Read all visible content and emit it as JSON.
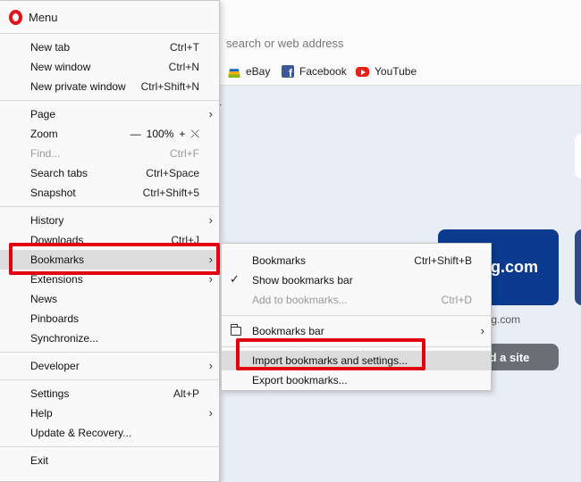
{
  "background": {
    "address_placeholder": "search or web address",
    "bookmarks": [
      {
        "label": "eBay",
        "icon": "ebay-icon"
      },
      {
        "label": "Facebook",
        "icon": "facebook-icon"
      },
      {
        "label": "YouTube",
        "icon": "youtube-icon"
      }
    ],
    "fragment_r": "r",
    "tile_text": "ing.com",
    "tile_caption": "ing.com",
    "add_site": "d a site"
  },
  "menu": {
    "title": "Menu",
    "new_tab": {
      "label": "New tab",
      "shortcut": "Ctrl+T"
    },
    "new_window": {
      "label": "New window",
      "shortcut": "Ctrl+N"
    },
    "new_private": {
      "label": "New private window",
      "shortcut": "Ctrl+Shift+N"
    },
    "page": {
      "label": "Page"
    },
    "zoom": {
      "label": "Zoom",
      "minus": "—",
      "value": "100%",
      "plus": "+",
      "fullscreen": "⤬"
    },
    "find": {
      "label": "Find...",
      "shortcut": "Ctrl+F"
    },
    "search_tabs": {
      "label": "Search tabs",
      "shortcut": "Ctrl+Space"
    },
    "snapshot": {
      "label": "Snapshot",
      "shortcut": "Ctrl+Shift+5"
    },
    "history": {
      "label": "History"
    },
    "downloads": {
      "label": "Downloads",
      "shortcut": "Ctrl+J"
    },
    "bookmarks": {
      "label": "Bookmarks"
    },
    "extensions": {
      "label": "Extensions"
    },
    "news": {
      "label": "News"
    },
    "pinboards": {
      "label": "Pinboards"
    },
    "synchronize": {
      "label": "Synchronize..."
    },
    "developer": {
      "label": "Developer"
    },
    "settings": {
      "label": "Settings",
      "shortcut": "Alt+P"
    },
    "help": {
      "label": "Help"
    },
    "update": {
      "label": "Update & Recovery..."
    },
    "exit": {
      "label": "Exit"
    },
    "arrow": "›"
  },
  "submenu": {
    "bookmarks": {
      "label": "Bookmarks",
      "shortcut": "Ctrl+Shift+B"
    },
    "show_bar": {
      "label": "Show bookmarks bar",
      "check": "✓"
    },
    "add": {
      "label": "Add to bookmarks...",
      "shortcut": "Ctrl+D"
    },
    "bar": {
      "label": "Bookmarks bar"
    },
    "import": {
      "label": "Import bookmarks and settings..."
    },
    "export": {
      "label": "Export bookmarks..."
    }
  },
  "colors": {
    "opera_red": "#e0151c",
    "highlight_red": "#e0000f"
  }
}
